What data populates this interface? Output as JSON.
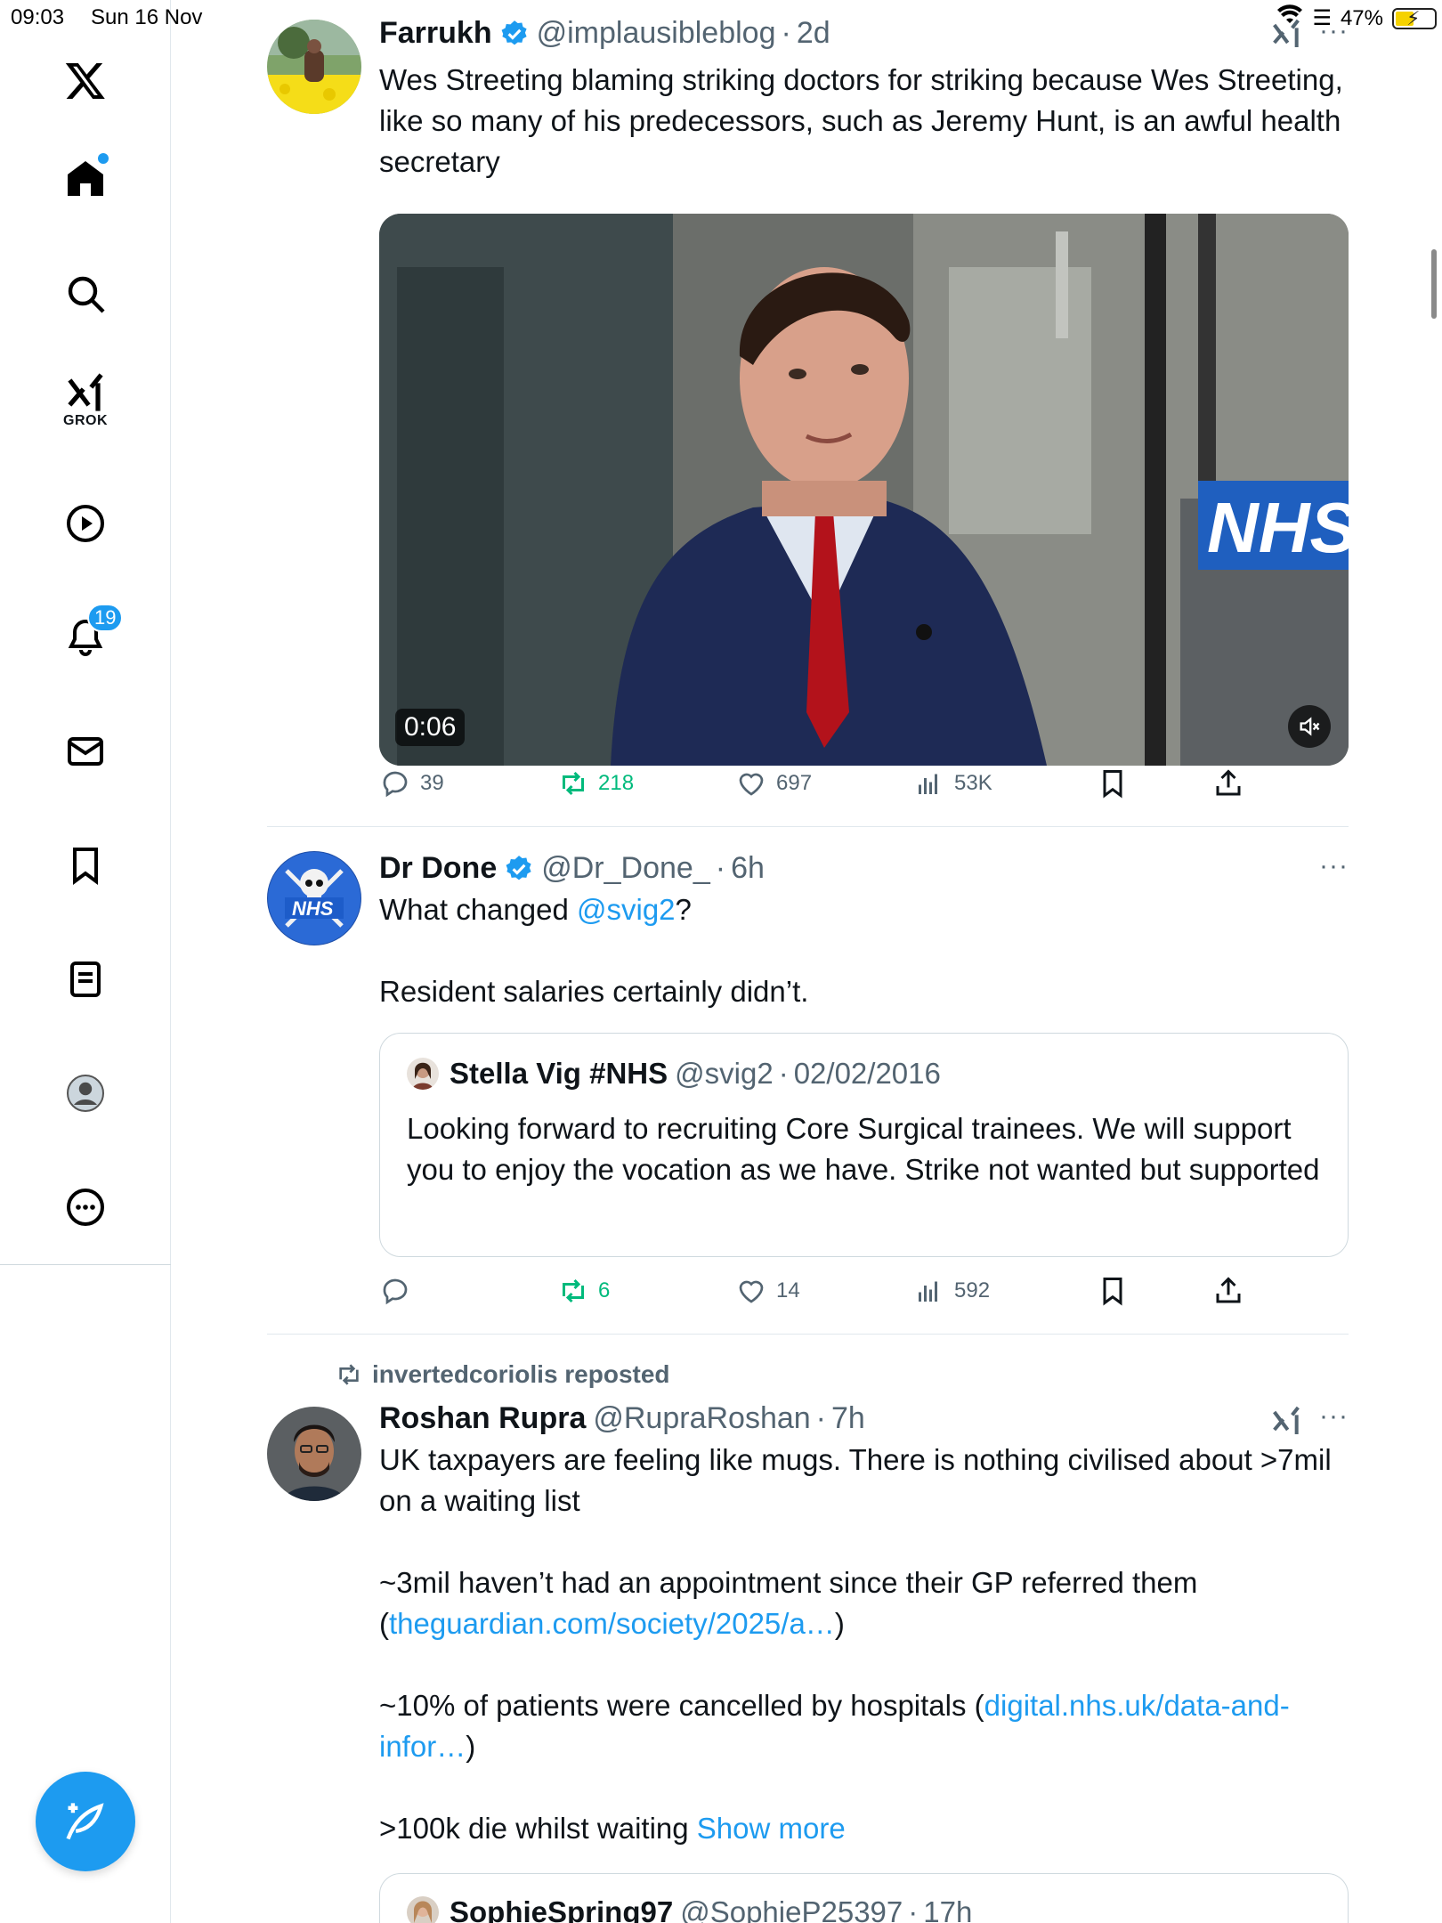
{
  "status_bar": {
    "time": "09:03",
    "date": "Sun 16 Nov",
    "battery": "47%"
  },
  "sidebar": {
    "grok_label": "GROK",
    "notifications_badge": "19",
    "items": [
      "home",
      "explore",
      "grok",
      "video",
      "notifications",
      "messages",
      "bookmarks",
      "lists",
      "profile",
      "more"
    ]
  },
  "tweets": [
    {
      "name": "Farrukh",
      "handle": "@implausibleblog",
      "time": "2d",
      "text": "Wes Streeting blaming striking doctors for striking because Wes Streeting, like so many of his predecessors, such as Jeremy Hunt, is an awful health secretary",
      "video_time": "0:06",
      "video_sign": "NHS",
      "replies": "39",
      "reposts": "218",
      "likes": "697",
      "views": "53K"
    },
    {
      "name": "Dr Done",
      "handle": "@Dr_Done_",
      "time": "6h",
      "text_before": "What changed ",
      "mention": "@svig2",
      "text_after": "?",
      "text_line2": "Resident salaries certainly didn’t.",
      "avatar_text": "NHS",
      "quote": {
        "name": "Stella Vig #NHS",
        "handle": "@svig2",
        "date": "02/02/2016",
        "text": "Looking forward to recruiting Core Surgical trainees. We will support you to enjoy the vocation as we have. Strike not wanted but supported"
      },
      "replies": "",
      "reposts": "6",
      "likes": "14",
      "views": "592"
    },
    {
      "repost_label": "invertedcoriolis reposted",
      "name": "Roshan Rupra",
      "handle": "@RupraRoshan",
      "time": "7h",
      "para1": "UK taxpayers are feeling like mugs. There is nothing civilised about >7mil on a waiting list",
      "para2": "~3mil haven’t had an appointment since their GP referred them",
      "link1": "theguardian.com/society/2025/a…",
      "para3": "~10% of patients were cancelled by hospitals (",
      "link2": "digital.nhs.uk/data-and-infor…",
      "para4": ">100k die whilst waiting ",
      "show_more": "Show more",
      "quote_name": "SophieSpring97",
      "quote_handle": "@SophieP25397",
      "quote_time": "17h"
    }
  ],
  "colors": {
    "accent": "#1d9bf0",
    "repost_green": "#00ba7c",
    "muted": "#536471"
  }
}
